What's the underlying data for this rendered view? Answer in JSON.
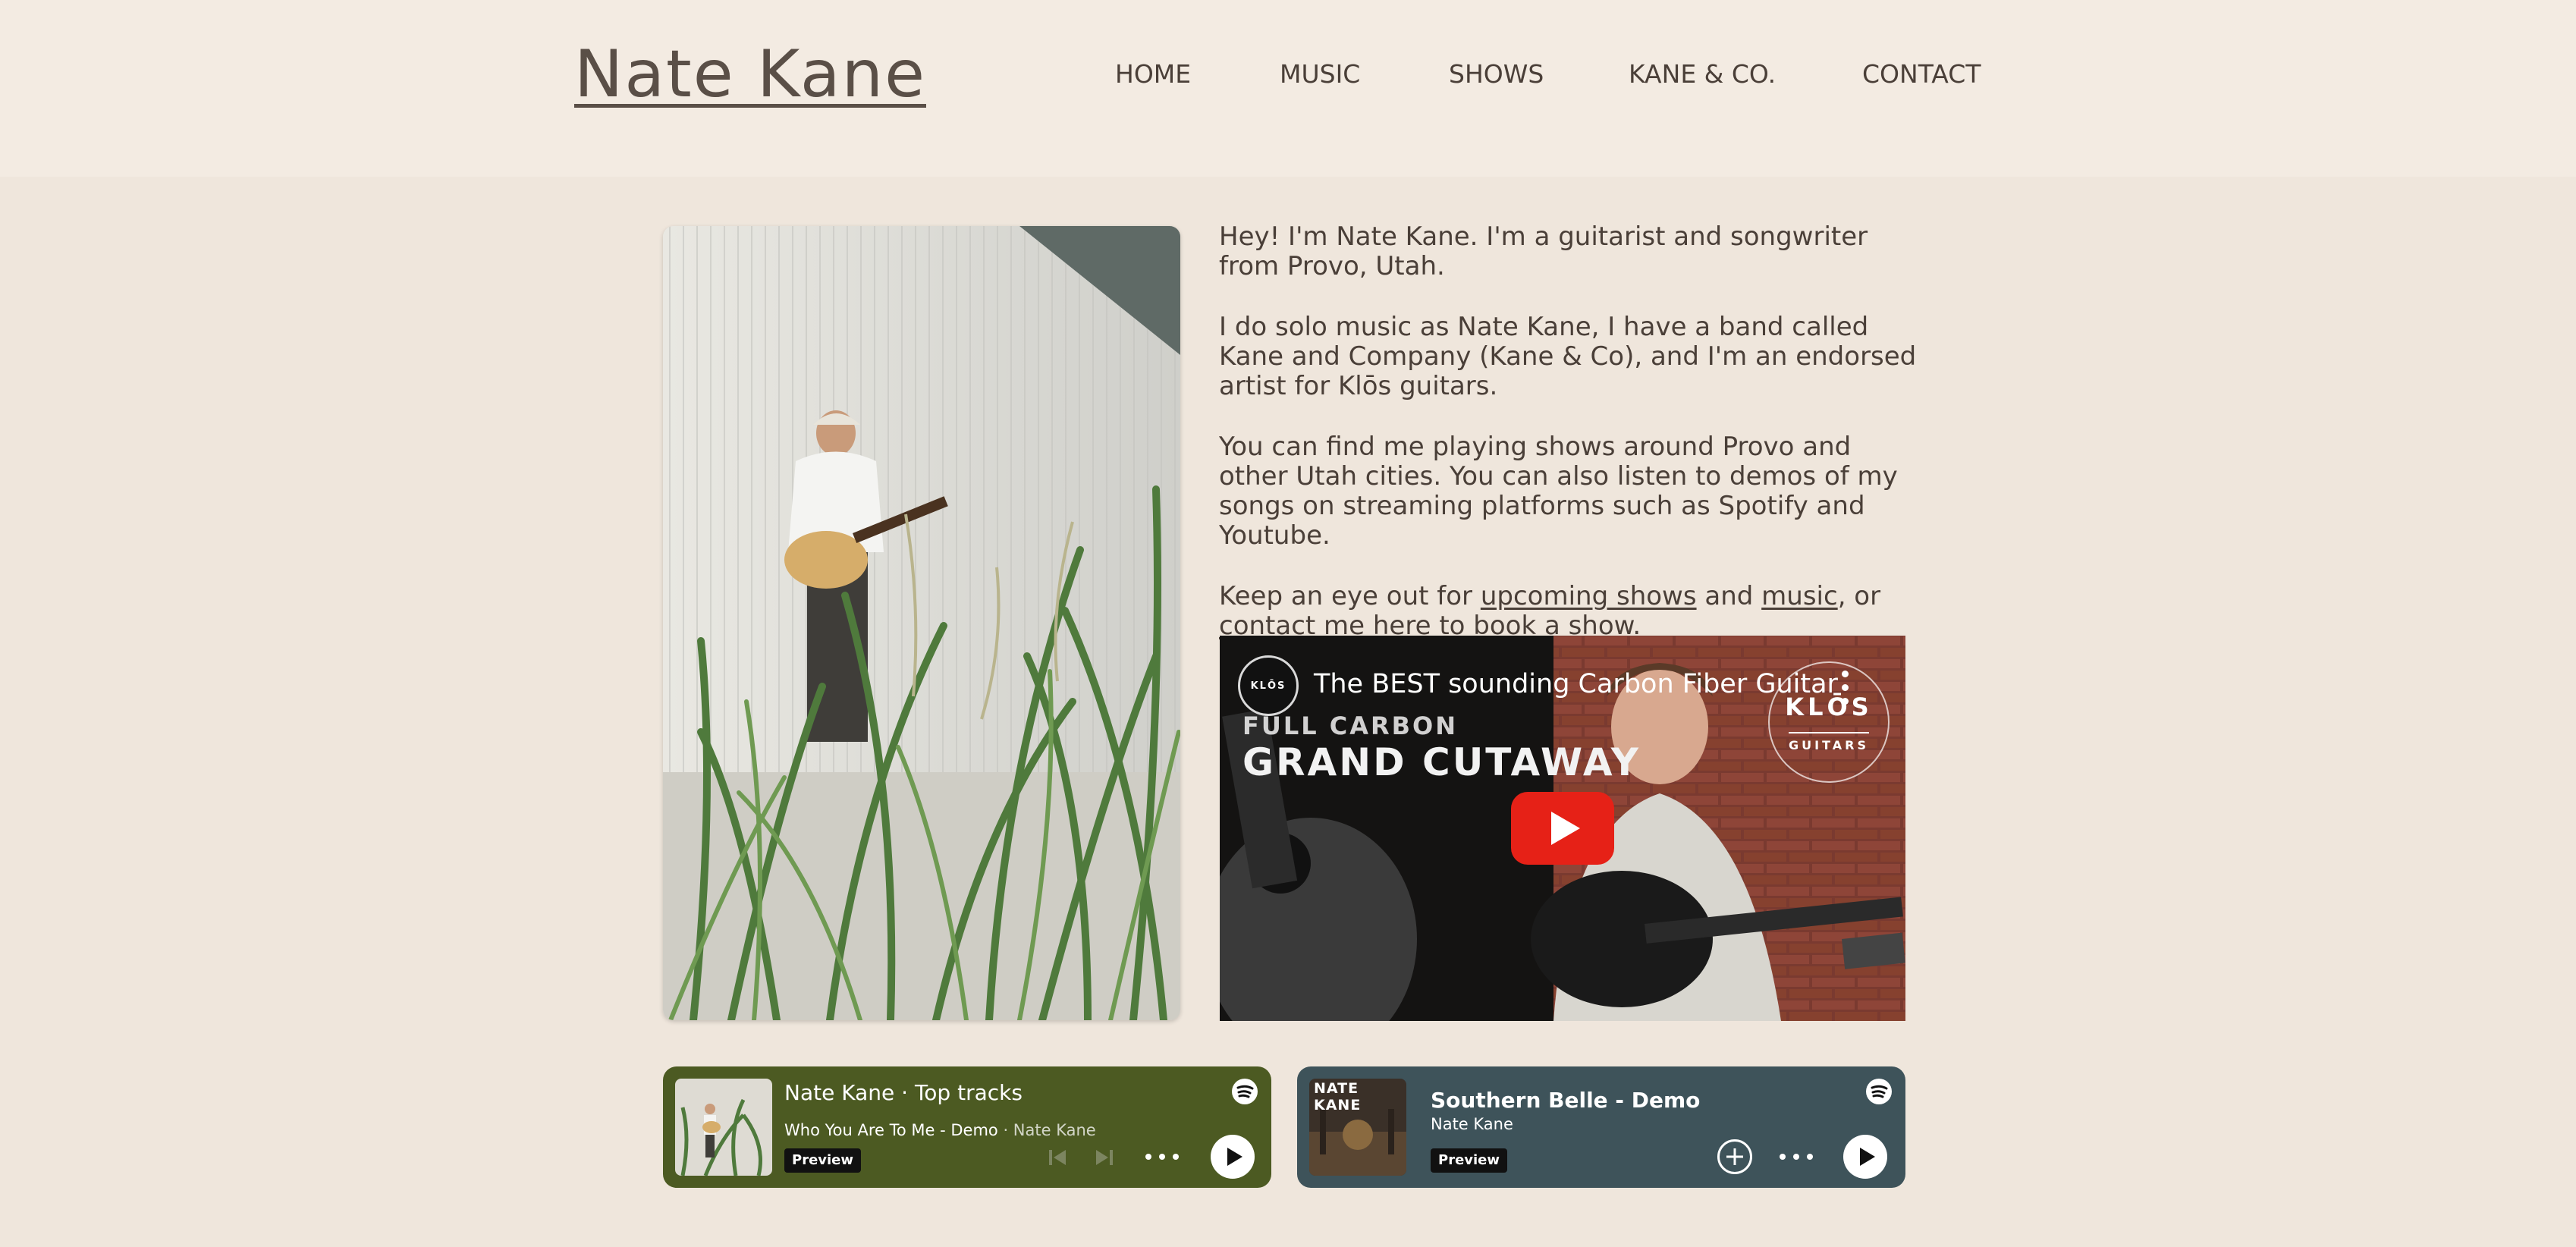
{
  "site": {
    "logo": "Nate Kane"
  },
  "nav": {
    "items": [
      {
        "label": "HOME"
      },
      {
        "label": "MUSIC"
      },
      {
        "label": "SHOWS"
      },
      {
        "label": "KANE & CO."
      },
      {
        "label": "CONTACT"
      }
    ]
  },
  "bio": {
    "p1": "Hey! I'm Nate Kane. I'm a guitarist and songwriter from Provo, Utah.",
    "p2": "I do solo music as Nate Kane, I have a band called Kane and Company (Kane & Co), and I'm an endorsed artist for Klōs guitars.",
    "p3": "You can find me playing shows around Provo and other Utah cities. You can also listen to demos of my songs on streaming platforms such as Spotify and Youtube.",
    "p4_pre": "Keep an eye out for ",
    "link_shows": "upcoming shows",
    "p4_and": " and ",
    "link_music": "music",
    "p4_or": ", or",
    "link_contact": "contact me here",
    "p4_post": " to book a show."
  },
  "video": {
    "title": "The BEST sounding Carbon Fiber Guitar",
    "channel_badge": "KLŌS",
    "overlay_line1": "FULL CARBON",
    "overlay_line2": "GRAND CUTAWAY",
    "logo_main": "KLŌS",
    "logo_sub": "GUITARS"
  },
  "spotify1": {
    "artist": "Nate Kane",
    "separator": "·",
    "list": "Top tracks",
    "track": "Who You Are To Me - Demo",
    "track_artist": "Nate Kane",
    "preview": "Preview",
    "bg": "#4c5a22"
  },
  "spotify2": {
    "title": "Southern Belle - Demo",
    "artist": "Nate Kane",
    "cover_label": "NATE KANE",
    "preview": "Preview",
    "bg": "#3e535a"
  },
  "colors": {
    "page_bg": "#efe6dc",
    "header_bg": "#f3ebe2",
    "text": "#4a3f38",
    "youtube_red": "#e62117"
  }
}
